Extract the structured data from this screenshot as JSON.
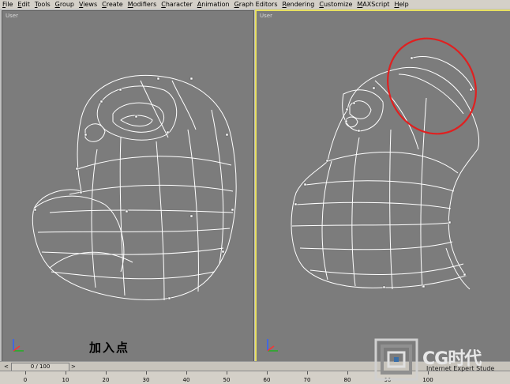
{
  "menu": [
    "File",
    "Edit",
    "Tools",
    "Group",
    "Views",
    "Create",
    "Modifiers",
    "Character",
    "Animation",
    "Graph Editors",
    "Rendering",
    "Customize",
    "MAXScript",
    "Help"
  ],
  "viewports": {
    "left_label": "User",
    "right_label": "User"
  },
  "caption": "加入点",
  "timeslider": {
    "label": "0 / 100",
    "left_arrow": "<",
    "right_arrow": ">"
  },
  "ruler_ticks": [
    "0",
    "10",
    "20",
    "30",
    "40",
    "50",
    "60",
    "70",
    "80",
    "90",
    "100"
  ],
  "watermark": {
    "logo": "CG时代",
    "sub": "Internet Expert Stude"
  },
  "colors": {
    "viewport_bg": "#7c7c7c",
    "active_border": "#e8e060",
    "wire": "#ffffff",
    "highlight_circle": "#e02020"
  },
  "icons": {
    "axis": "axis-tripod-icon",
    "logo": "cg-logo-icon"
  }
}
